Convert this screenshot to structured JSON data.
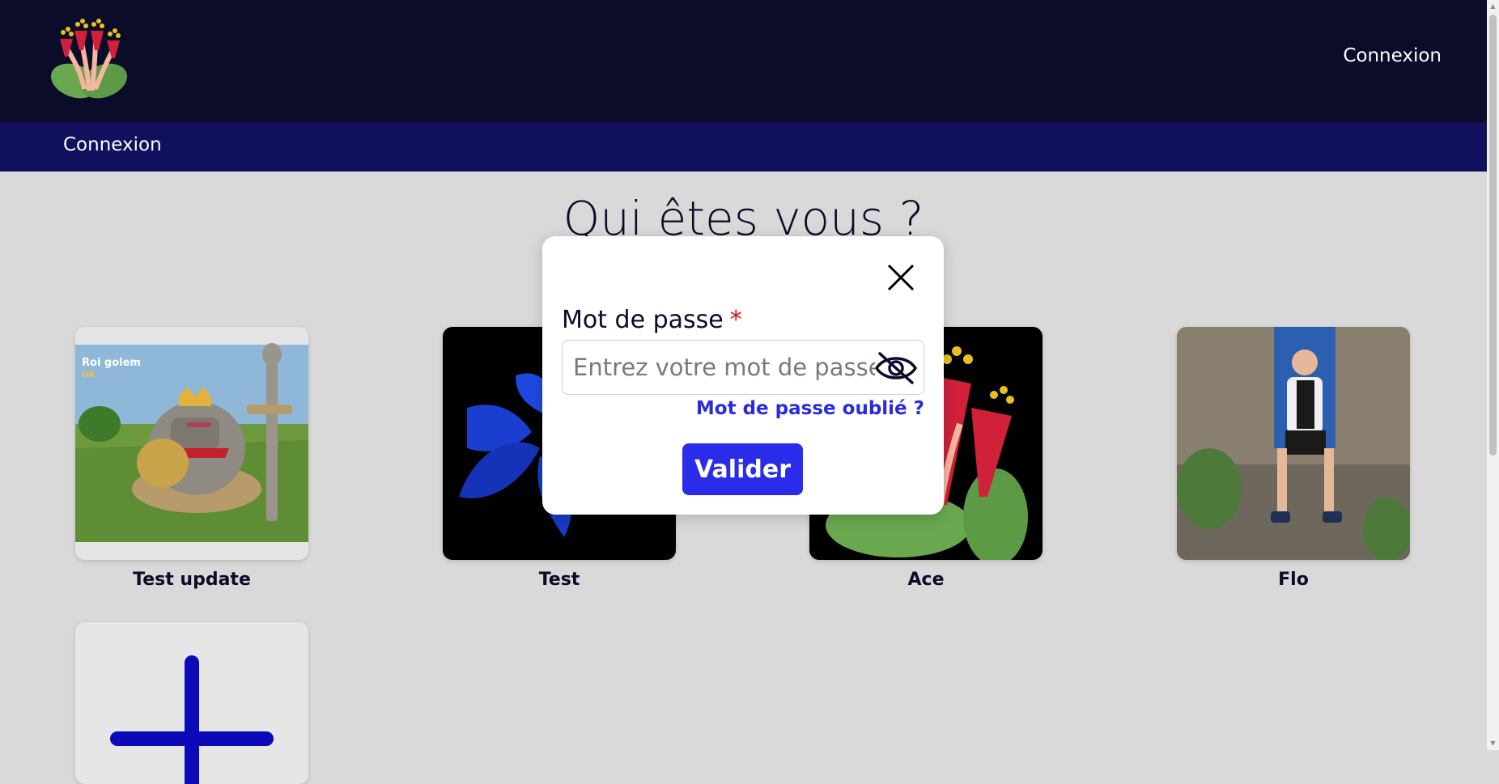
{
  "header": {
    "login_link": "Connexion",
    "logo_name": "flower-logo"
  },
  "subheader": {
    "title": "Connexion"
  },
  "page": {
    "title": "Qui êtes vous ?"
  },
  "profiles": [
    {
      "name": "Test update",
      "image": "roi-golem-image"
    },
    {
      "name": "Test",
      "image": "blue-flower-image"
    },
    {
      "name": "Ace",
      "image": "red-flower-image"
    },
    {
      "name": "Flo",
      "image": "person-photo"
    }
  ],
  "add_profile": {
    "icon": "plus-icon"
  },
  "modal": {
    "label": "Mot de passe",
    "required_mark": "*",
    "placeholder": "Entrez votre mot de passe",
    "forgot_label": "Mot de passe oublié ?",
    "submit_label": "Valider",
    "close_icon": "close-icon",
    "toggle_icon": "eye-off-icon"
  },
  "thumbnail_text": {
    "title": "Roi golem",
    "subtitle": "OR"
  },
  "colors": {
    "topbar": "#0b0b2a",
    "subbar": "#10105e",
    "accent": "#2b2bea",
    "link": "#2a2adf",
    "required": "#e01010",
    "background": "#d9d9d9"
  }
}
